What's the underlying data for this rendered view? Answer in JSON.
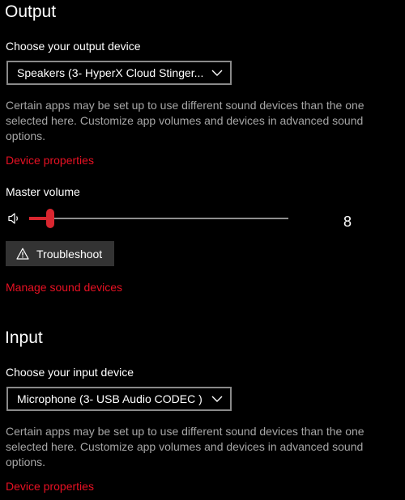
{
  "output": {
    "title": "Output",
    "device_label": "Choose your output device",
    "device_selected": "Speakers (3- HyperX Cloud Stinger...",
    "help_text": "Certain apps may be set up to use different sound devices than the one selected here. Customize app volumes and devices in advanced sound options.",
    "device_properties_link": "Device properties",
    "master_volume_label": "Master volume",
    "volume_value": "8",
    "volume_fraction": 0.08,
    "troubleshoot_label": "Troubleshoot",
    "manage_devices_link": "Manage sound devices"
  },
  "input": {
    "title": "Input",
    "device_label": "Choose your input device",
    "device_selected": "Microphone (3- USB Audio CODEC )",
    "help_text": "Certain apps may be set up to use different sound devices than the one selected here. Customize app volumes and devices in advanced sound options.",
    "device_properties_link": "Device properties"
  },
  "colors": {
    "accent": "#e81123",
    "slider_accent": "#d9262f",
    "background": "#000000",
    "help_text": "#a6a6a6",
    "button_bg": "#333333"
  },
  "icons": {
    "dropdown": "chevron-down-icon",
    "volume": "speaker-icon",
    "troubleshoot": "warning-icon"
  }
}
